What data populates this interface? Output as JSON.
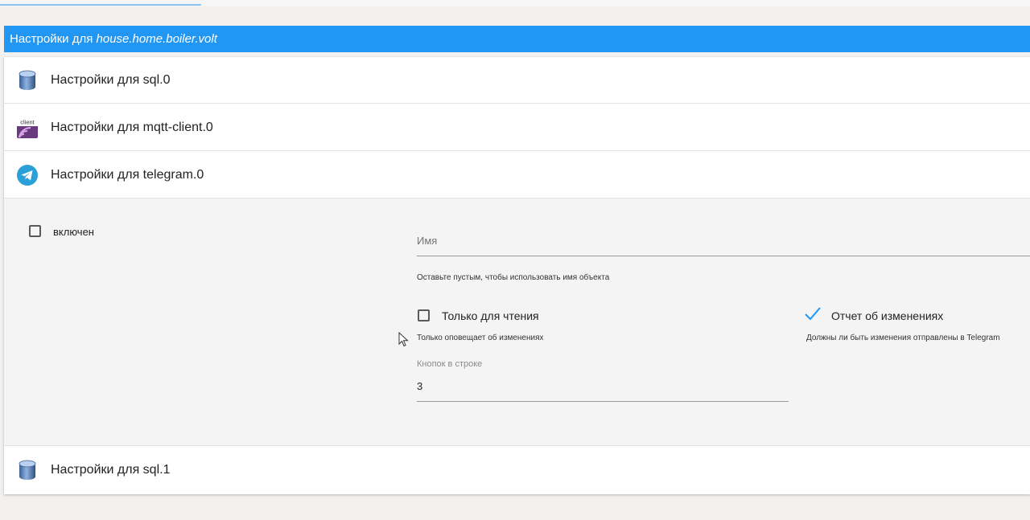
{
  "header": {
    "prefix": "Настройки для ",
    "object_id": "house.home.boiler.volt"
  },
  "adapters": [
    {
      "label": "Настройки для sql.0",
      "icon": "database-icon"
    },
    {
      "label": "Настройки для mqtt-client.0",
      "icon": "mqtt-client-icon",
      "icon_text": "client"
    },
    {
      "label": "Настройки для telegram.0",
      "icon": "telegram-icon"
    },
    {
      "label": "Настройки для sql.1",
      "icon": "database-icon"
    }
  ],
  "telegram_settings": {
    "enabled_label": "включен",
    "name_placeholder": "Имя",
    "name_value": "",
    "name_helper": "Оставьте пустым, чтобы использовать имя объекта",
    "readonly_label": "Только для чтения",
    "readonly_helper": "Только оповещает об изменениях",
    "report_label": "Отчет об изменениях",
    "report_helper": "Должны ли быть изменения отправлены в Telegram",
    "buttons_label": "Кнопок в строке",
    "buttons_value": "3"
  },
  "colors": {
    "accent": "#2196f3",
    "check": "#2196f3"
  }
}
